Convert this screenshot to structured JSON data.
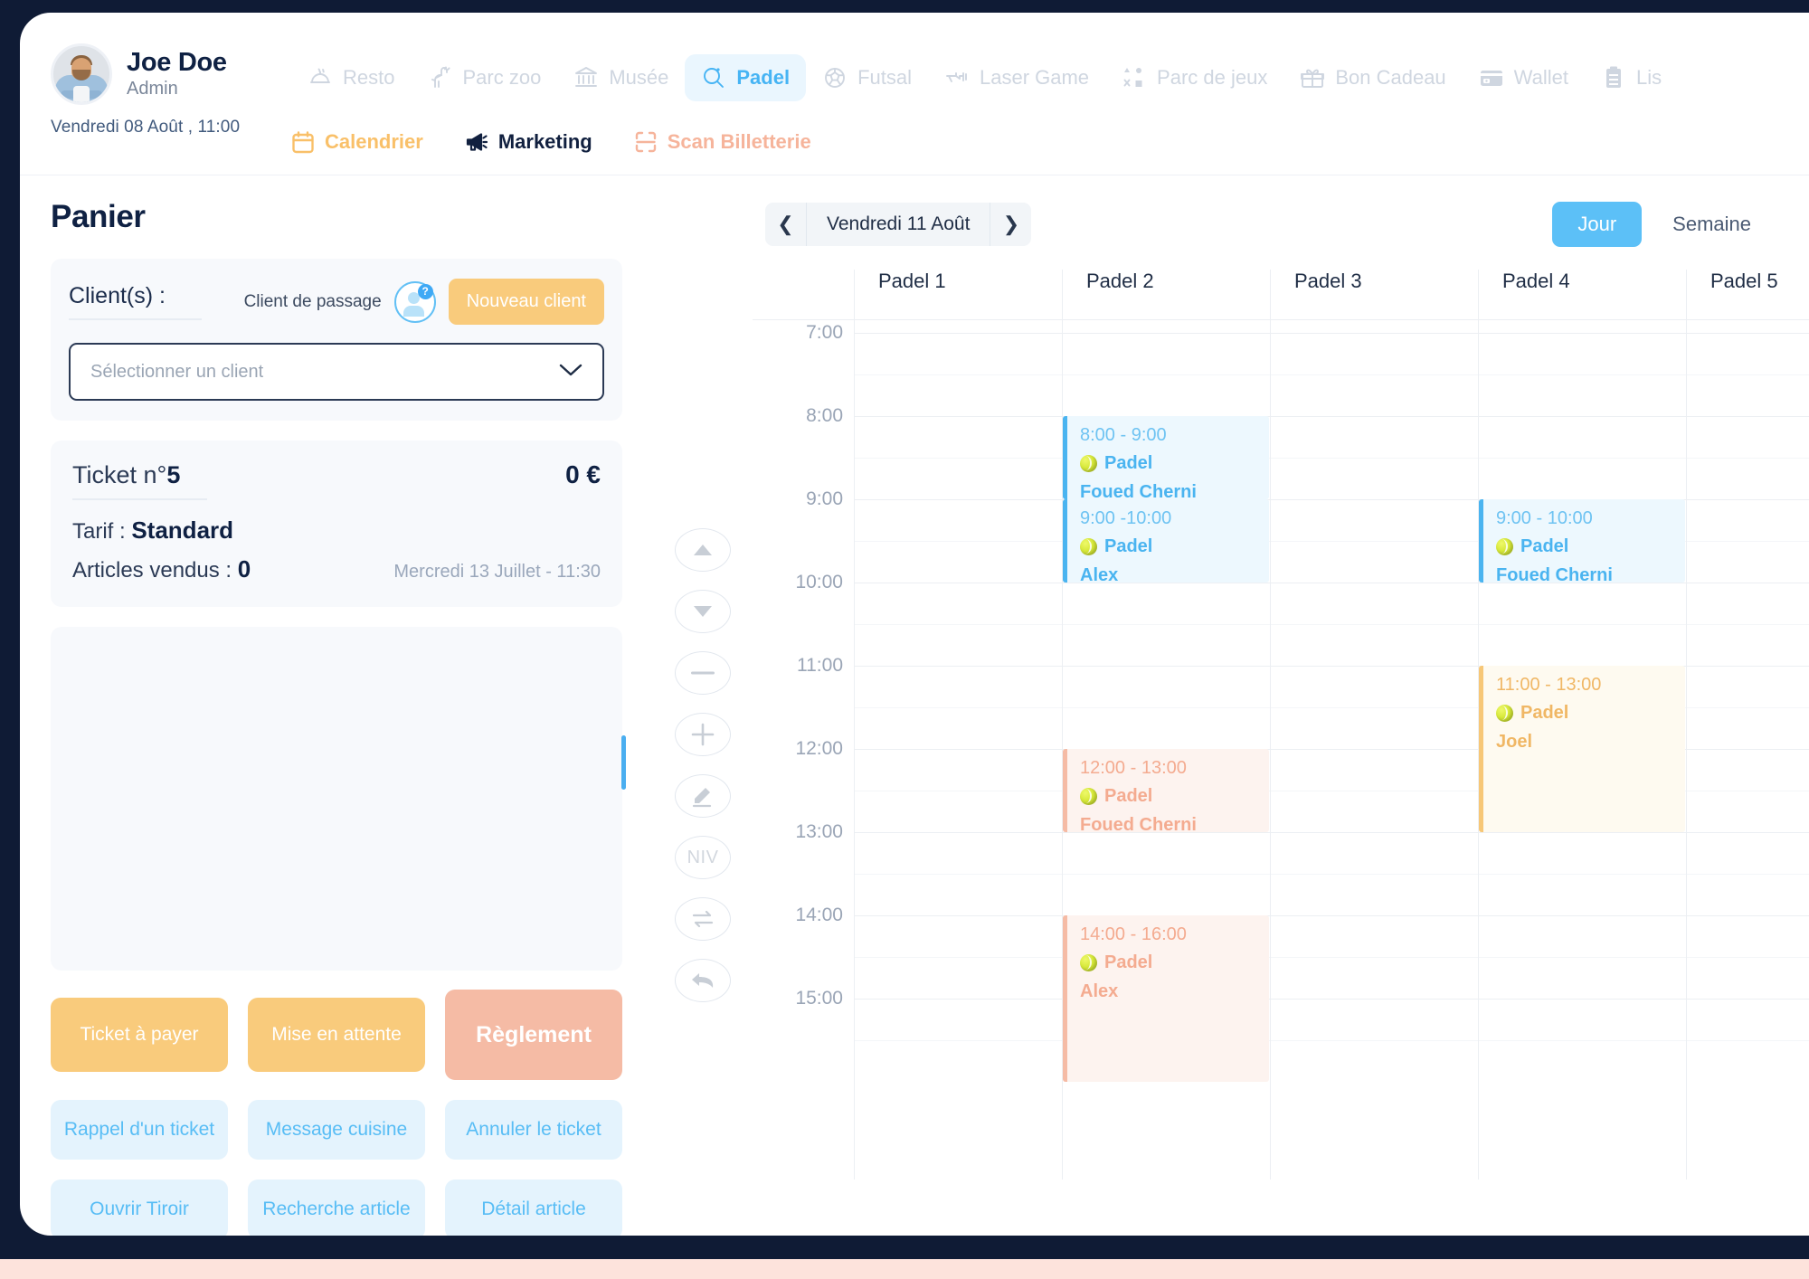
{
  "user": {
    "name": "Joe Doe",
    "role": "Admin",
    "datetime": "Vendredi 08 Août , 11:00"
  },
  "nav_main": [
    {
      "label": "Resto",
      "icon": "resto-icon",
      "active": false
    },
    {
      "label": "Parc zoo",
      "icon": "giraffe-icon",
      "active": false
    },
    {
      "label": "Musée",
      "icon": "museum-icon",
      "active": false
    },
    {
      "label": "Padel",
      "icon": "padel-racket-icon",
      "active": true
    },
    {
      "label": "Futsal",
      "icon": "soccer-ball-icon",
      "active": false
    },
    {
      "label": "Laser Game",
      "icon": "laser-gun-icon",
      "active": false
    },
    {
      "label": "Parc de jeux",
      "icon": "shapes-icon",
      "active": false
    },
    {
      "label": "Bon Cadeau",
      "icon": "gift-icon",
      "active": false
    },
    {
      "label": "Wallet",
      "icon": "wallet-icon",
      "active": false
    },
    {
      "label": "Lis",
      "icon": "clipboard-icon",
      "active": false
    }
  ],
  "nav_sub": [
    {
      "label": "Calendrier",
      "icon": "calendar-icon"
    },
    {
      "label": "Marketing",
      "icon": "megaphone-icon"
    },
    {
      "label": "Scan Billetterie",
      "icon": "scan-icon"
    }
  ],
  "panier": {
    "title": "Panier",
    "client_label": "Client(s) :",
    "client_passage": "Client de passage",
    "client_help_badge": "?",
    "new_client_button": "Nouveau client",
    "select_client_placeholder": "Sélectionner un client",
    "ticket": {
      "label": "Ticket n°",
      "number": "5",
      "price": "0 €",
      "tarif_label": "Tarif : ",
      "tarif_value": "Standard",
      "articles_label": "Articles vendus : ",
      "articles_value": "0",
      "date": "Mercredi 13 Juillet - 11:30"
    },
    "actions_primary": [
      "Ticket à payer",
      "Mise en attente"
    ],
    "reglement": "Règlement",
    "actions_soft_row1": [
      "Rappel d'un ticket",
      "Message cuisine",
      "Annuler le ticket"
    ],
    "actions_soft_row2": [
      "Ouvrir Tiroir",
      "Recherche article",
      "Détail article"
    ]
  },
  "controls": [
    {
      "name": "scroll-up-button",
      "glyph": "▲"
    },
    {
      "name": "scroll-down-button",
      "glyph": "▼"
    },
    {
      "name": "decrement-button",
      "glyph": "–"
    },
    {
      "name": "increment-button",
      "glyph": "+"
    },
    {
      "name": "edit-button",
      "glyph": "✎"
    },
    {
      "name": "niv-button",
      "glyph": "NIV"
    },
    {
      "name": "transfer-button",
      "glyph": "⇄"
    },
    {
      "name": "undo-button",
      "glyph": "↰"
    }
  ],
  "calendar": {
    "prev_label": "❮",
    "next_label": "❯",
    "current_date": "Vendredi 11 Août",
    "view_day": "Jour",
    "view_week": "Semaine",
    "active_view": "Jour",
    "columns": [
      "Padel 1",
      "Padel 2",
      "Padel 3",
      "Padel 4",
      "Padel 5"
    ],
    "times": [
      "7:00",
      "8:00",
      "9:00",
      "10:00",
      "11:00",
      "12:00",
      "13:00",
      "14:00",
      "15:00"
    ],
    "events": [
      {
        "column": 1,
        "start": "8:00",
        "end": "9:00",
        "time_text": "8:00 - 9:00",
        "sport": "Padel",
        "person": "Foued Cherni",
        "color": "blue"
      },
      {
        "column": 1,
        "start": "9:00",
        "end": "10:00",
        "time_text": "9:00 -10:00",
        "sport": "Padel",
        "person": "Alex",
        "color": "blue"
      },
      {
        "column": 3,
        "start": "9:00",
        "end": "10:00",
        "time_text": "9:00 - 10:00",
        "sport": "Padel",
        "person": "Foued Cherni",
        "color": "blue"
      },
      {
        "column": 3,
        "start": "11:00",
        "end": "13:00",
        "time_text": "11:00 - 13:00",
        "sport": "Padel",
        "person": "Joel",
        "color": "yellow"
      },
      {
        "column": 1,
        "start": "12:00",
        "end": "13:00",
        "time_text": "12:00 - 13:00",
        "sport": "Padel",
        "person": "Foued Cherni",
        "color": "peach"
      },
      {
        "column": 1,
        "start": "14:00",
        "end": "16:00",
        "time_text": "14:00 - 16:00",
        "sport": "Padel",
        "person": "Alex",
        "color": "peach"
      }
    ]
  },
  "colors": {
    "accent_blue": "#4ab4f0",
    "accent_yellow": "#f9cb7c",
    "accent_peach": "#f5bba5",
    "dark_navy": "#0f2143"
  }
}
